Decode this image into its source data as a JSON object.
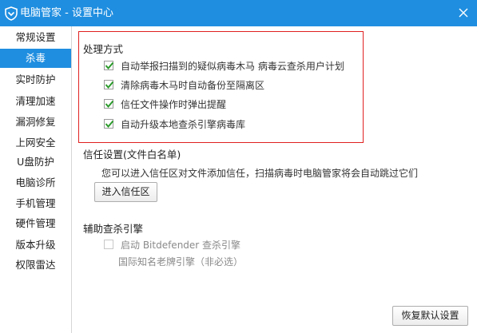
{
  "window": {
    "title": "电脑管家 - 设置中心"
  },
  "sidebar": {
    "items": [
      {
        "label": "常规设置",
        "active": false
      },
      {
        "label": "杀毒",
        "active": true
      },
      {
        "label": "实时防护",
        "active": false
      },
      {
        "label": "清理加速",
        "active": false
      },
      {
        "label": "漏洞修复",
        "active": false
      },
      {
        "label": "上网安全",
        "active": false
      },
      {
        "label": "U盘防护",
        "active": false
      },
      {
        "label": "电脑诊所",
        "active": false
      },
      {
        "label": "手机管理",
        "active": false
      },
      {
        "label": "硬件管理",
        "active": false
      },
      {
        "label": "版本升级",
        "active": false
      },
      {
        "label": "权限雷达",
        "active": false
      }
    ]
  },
  "handling": {
    "title": "处理方式",
    "options": [
      {
        "label": "自动举报扫描到的疑似病毒木马   病毒云查杀用户计划",
        "checked": true
      },
      {
        "label": "清除病毒木马时自动备份至隔离区",
        "checked": true
      },
      {
        "label": "信任文件操作时弹出提醒",
        "checked": true
      },
      {
        "label": "自动升级本地查杀引擎病毒库",
        "checked": true
      }
    ]
  },
  "trust": {
    "title": "信任设置(文件白名单)",
    "description": "您可以进入信任区对文件添加信任，扫描病毒时电脑管家将会自动跳过它们",
    "button": "进入信任区"
  },
  "engine": {
    "title": "辅助查杀引擎",
    "option": {
      "label": "启动 Bitdefender 查杀引擎",
      "checked": false
    },
    "hint": "国际知名老牌引擎（非必选）"
  },
  "footer": {
    "restore_button": "恢复默认设置"
  },
  "colors": {
    "accent": "#1f8ee0",
    "highlight_border": "#e02020",
    "check": "#2a9a2a"
  }
}
